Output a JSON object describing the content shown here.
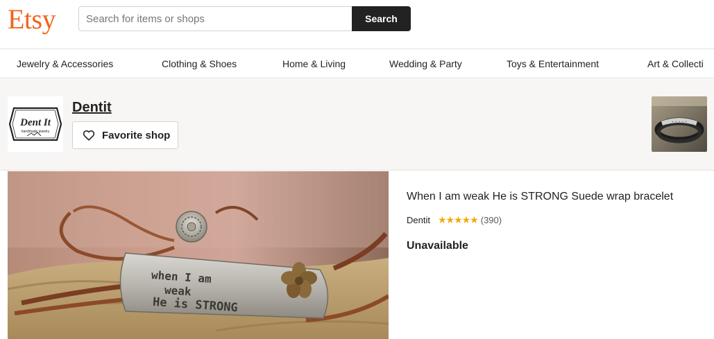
{
  "header": {
    "logo": "Etsy",
    "search": {
      "placeholder": "Search for items or shops",
      "value": "",
      "button_label": "Search"
    },
    "brand_color": "#F1641E"
  },
  "categories": [
    "Jewelry & Accessories",
    "Clothing & Shoes",
    "Home & Living",
    "Wedding & Party",
    "Toys & Entertainment",
    "Art & Collecti"
  ],
  "shop": {
    "name": "Dentit",
    "logo_text": "Dent It",
    "logo_subtext": "handmade jewelry",
    "favorite_label": "Favorite shop",
    "favorite_icon": "heart-outline-icon"
  },
  "listing": {
    "title": "When I am weak He is STRONG Suede wrap bracelet",
    "seller": "Dentit",
    "rating": 5,
    "stars": "★★★★★",
    "review_count": "(390)",
    "status": "Unavailable",
    "image_stamp_lines": [
      "when I am",
      "weak",
      "He is STRONG"
    ]
  }
}
